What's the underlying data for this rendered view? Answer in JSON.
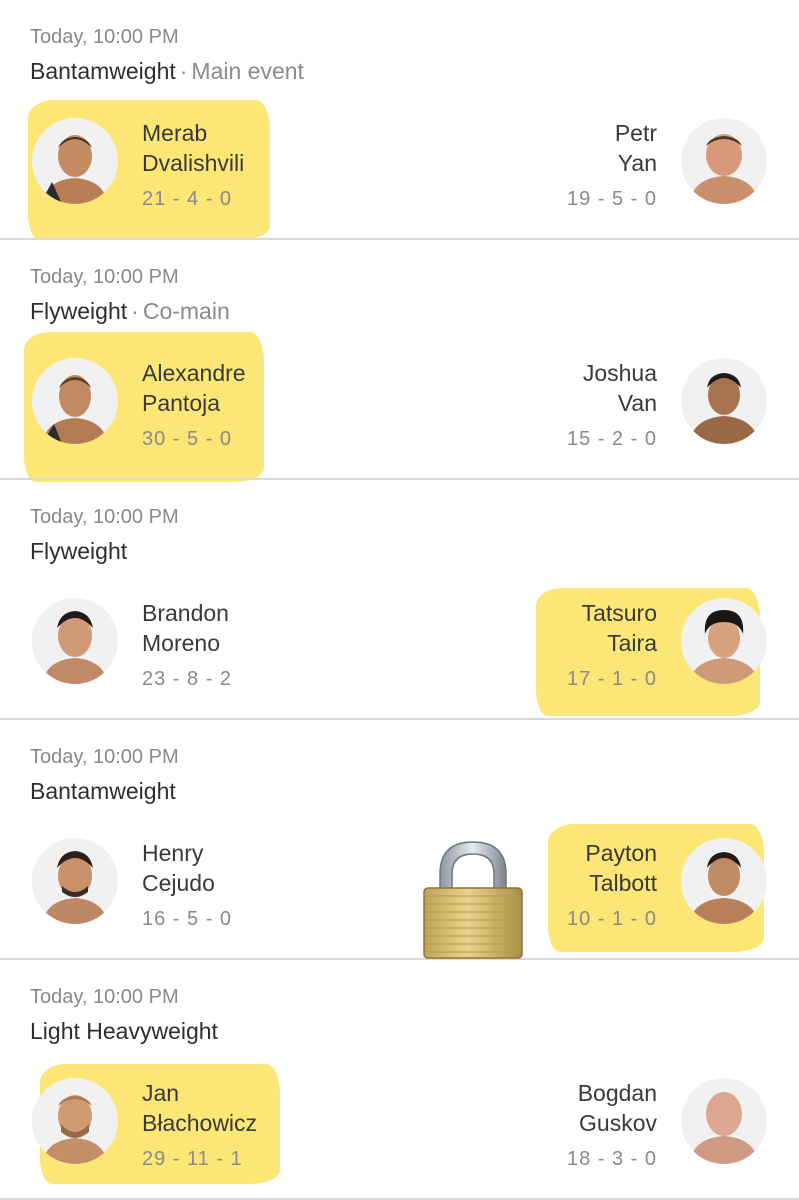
{
  "fights": [
    {
      "time": "Today, 10:00 PM",
      "division": "Bantamweight",
      "tag": "Main event",
      "left": {
        "first": "Merab",
        "last": "Dvalishvili",
        "record": "21 - 4 - 0",
        "highlighted": true
      },
      "right": {
        "first": "Petr",
        "last": "Yan",
        "record": "19 - 5 - 0",
        "highlighted": false
      }
    },
    {
      "time": "Today, 10:00 PM",
      "division": "Flyweight",
      "tag": "Co-main",
      "left": {
        "first": "Alexandre",
        "last": "Pantoja",
        "record": "30 - 5 - 0",
        "highlighted": true
      },
      "right": {
        "first": "Joshua",
        "last": "Van",
        "record": "15 - 2 - 0",
        "highlighted": false
      }
    },
    {
      "time": "Today, 10:00 PM",
      "division": "Flyweight",
      "tag": "",
      "left": {
        "first": "Brandon",
        "last": "Moreno",
        "record": "23 - 8 - 2",
        "highlighted": false
      },
      "right": {
        "first": "Tatsuro",
        "last": "Taira",
        "record": "17 - 1 - 0",
        "highlighted": true
      }
    },
    {
      "time": "Today, 10:00 PM",
      "division": "Bantamweight",
      "tag": "",
      "left": {
        "first": "Henry",
        "last": "Cejudo",
        "record": "16 - 5 - 0",
        "highlighted": false
      },
      "right": {
        "first": "Payton",
        "last": "Talbott",
        "record": "10 - 1 - 0",
        "highlighted": true
      }
    },
    {
      "time": "Today, 10:00 PM",
      "division": "Light Heavyweight",
      "tag": "",
      "left": {
        "first": "Jan",
        "last": "Błachowicz",
        "record": "29 - 11 - 1",
        "highlighted": true
      },
      "right": {
        "first": "Bogdan",
        "last": "Guskov",
        "record": "18 - 3 - 0",
        "highlighted": false
      }
    }
  ],
  "highlight_color": "#fbe46a",
  "lock_icon": "lock-icon"
}
